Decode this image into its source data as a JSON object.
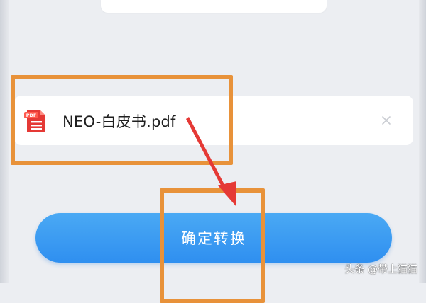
{
  "file": {
    "name": "NEO-白皮书.pdf",
    "icon": "pdf-file-icon",
    "icon_label": "PDF",
    "remove_icon": "close-icon"
  },
  "actions": {
    "confirm_label": "确定转换"
  },
  "watermark": {
    "text": "头条 @带上猫猫"
  },
  "colors": {
    "background": "#eceef2",
    "card": "#ffffff",
    "button_blue": "#3a9cf2",
    "highlight_orange": "#e8923a",
    "arrow_red": "#e53935",
    "pdf_red": "#e53935"
  }
}
